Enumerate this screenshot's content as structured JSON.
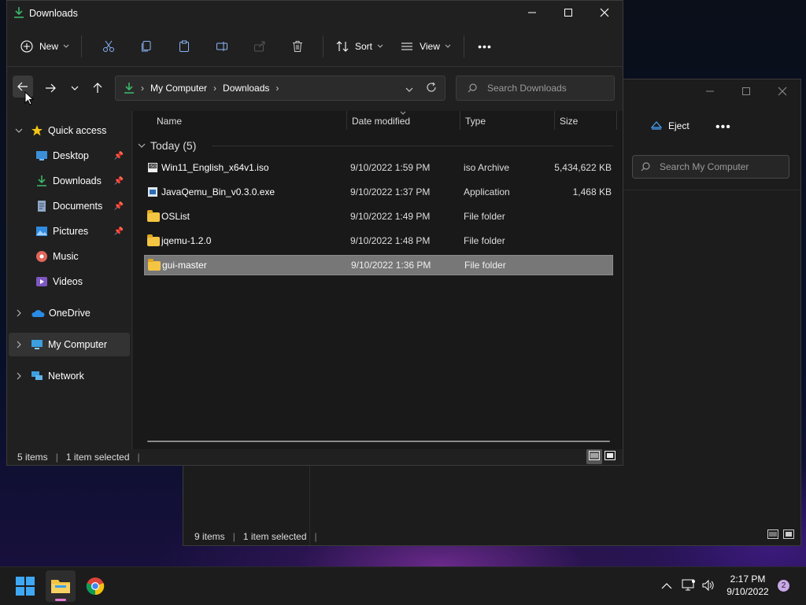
{
  "background_window": {
    "eject_label": "Eject",
    "search_placeholder": "Search My Computer",
    "status_items": "9 items",
    "status_selected": "1 item selected"
  },
  "window": {
    "title": "Downloads",
    "toolbar": {
      "new_label": "New",
      "sort_label": "Sort",
      "view_label": "View"
    },
    "address": {
      "crumbs": [
        "My Computer",
        "Downloads"
      ],
      "search_placeholder": "Search Downloads"
    },
    "nav": {
      "items": [
        {
          "label": "Quick access",
          "icon": "star-icon"
        },
        {
          "label": "Desktop",
          "icon": "desktop-icon",
          "pinned": true
        },
        {
          "label": "Downloads",
          "icon": "download-icon",
          "pinned": true
        },
        {
          "label": "Documents",
          "icon": "document-icon",
          "pinned": true
        },
        {
          "label": "Pictures",
          "icon": "picture-icon",
          "pinned": true
        },
        {
          "label": "Music",
          "icon": "music-icon"
        },
        {
          "label": "Videos",
          "icon": "video-icon"
        },
        {
          "label": "OneDrive",
          "icon": "cloud-icon"
        },
        {
          "label": "My Computer",
          "icon": "computer-icon"
        },
        {
          "label": "Network",
          "icon": "network-icon"
        }
      ]
    },
    "columns": [
      "Name",
      "Date modified",
      "Type",
      "Size"
    ],
    "group_label": "Today (5)",
    "files": [
      {
        "name": "Win11_English_x64v1.iso",
        "date": "9/10/2022 1:59 PM",
        "type": "iso Archive",
        "size": "5,434,622 KB",
        "icon": "iso-file-icon"
      },
      {
        "name": "JavaQemu_Bin_v0.3.0.exe",
        "date": "9/10/2022 1:37 PM",
        "type": "Application",
        "size": "1,468 KB",
        "icon": "exe-file-icon"
      },
      {
        "name": "OSList",
        "date": "9/10/2022 1:49 PM",
        "type": "File folder",
        "size": "",
        "icon": "folder-icon"
      },
      {
        "name": "jqemu-1.2.0",
        "date": "9/10/2022 1:48 PM",
        "type": "File folder",
        "size": "",
        "icon": "folder-icon"
      },
      {
        "name": "gui-master",
        "date": "9/10/2022 1:36 PM",
        "type": "File folder",
        "size": "",
        "icon": "folder-icon",
        "selected": true
      }
    ],
    "status": {
      "items": "5 items",
      "selected": "1 item selected"
    }
  },
  "taskbar": {
    "time": "2:17 PM",
    "date": "9/10/2022",
    "notification_count": "2"
  },
  "colors": {
    "accent": "#0078d4",
    "selection": "#777777",
    "download_green": "#3bb56a",
    "folder_yellow": "#f4c443"
  }
}
